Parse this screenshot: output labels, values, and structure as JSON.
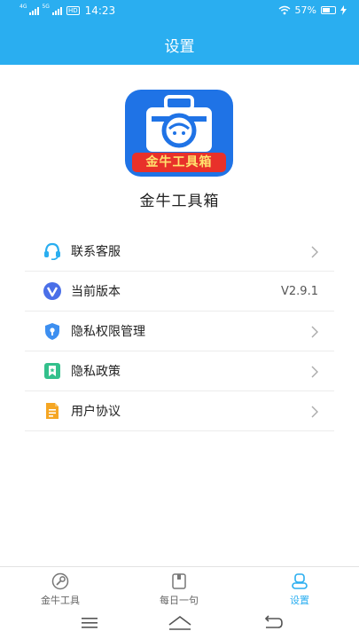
{
  "status_bar": {
    "network_1": "4G",
    "network_2": "5G",
    "hd": "HD",
    "time": "14:23",
    "battery": "57%"
  },
  "header": {
    "title": "设置"
  },
  "app": {
    "logo_text": "金牛工具箱",
    "name": "金牛工具箱"
  },
  "menu": [
    {
      "label": "联系客服",
      "icon": "headset-icon",
      "value": ""
    },
    {
      "label": "当前版本",
      "icon": "version-icon",
      "value": "V2.9.1"
    },
    {
      "label": "隐私权限管理",
      "icon": "privacy-shield-icon",
      "value": ""
    },
    {
      "label": "隐私政策",
      "icon": "policy-bookmark-icon",
      "value": ""
    },
    {
      "label": "用户协议",
      "icon": "agreement-document-icon",
      "value": ""
    }
  ],
  "tabs": [
    {
      "label": "金牛工具",
      "icon": "toolbox-tab-icon",
      "active": false
    },
    {
      "label": "每日一句",
      "icon": "daily-quote-tab-icon",
      "active": false
    },
    {
      "label": "设置",
      "icon": "settings-tab-icon",
      "active": true
    }
  ],
  "colors": {
    "accent": "#2aaef0",
    "logo_blue": "#1f73e6",
    "logo_red": "#e8312a"
  }
}
